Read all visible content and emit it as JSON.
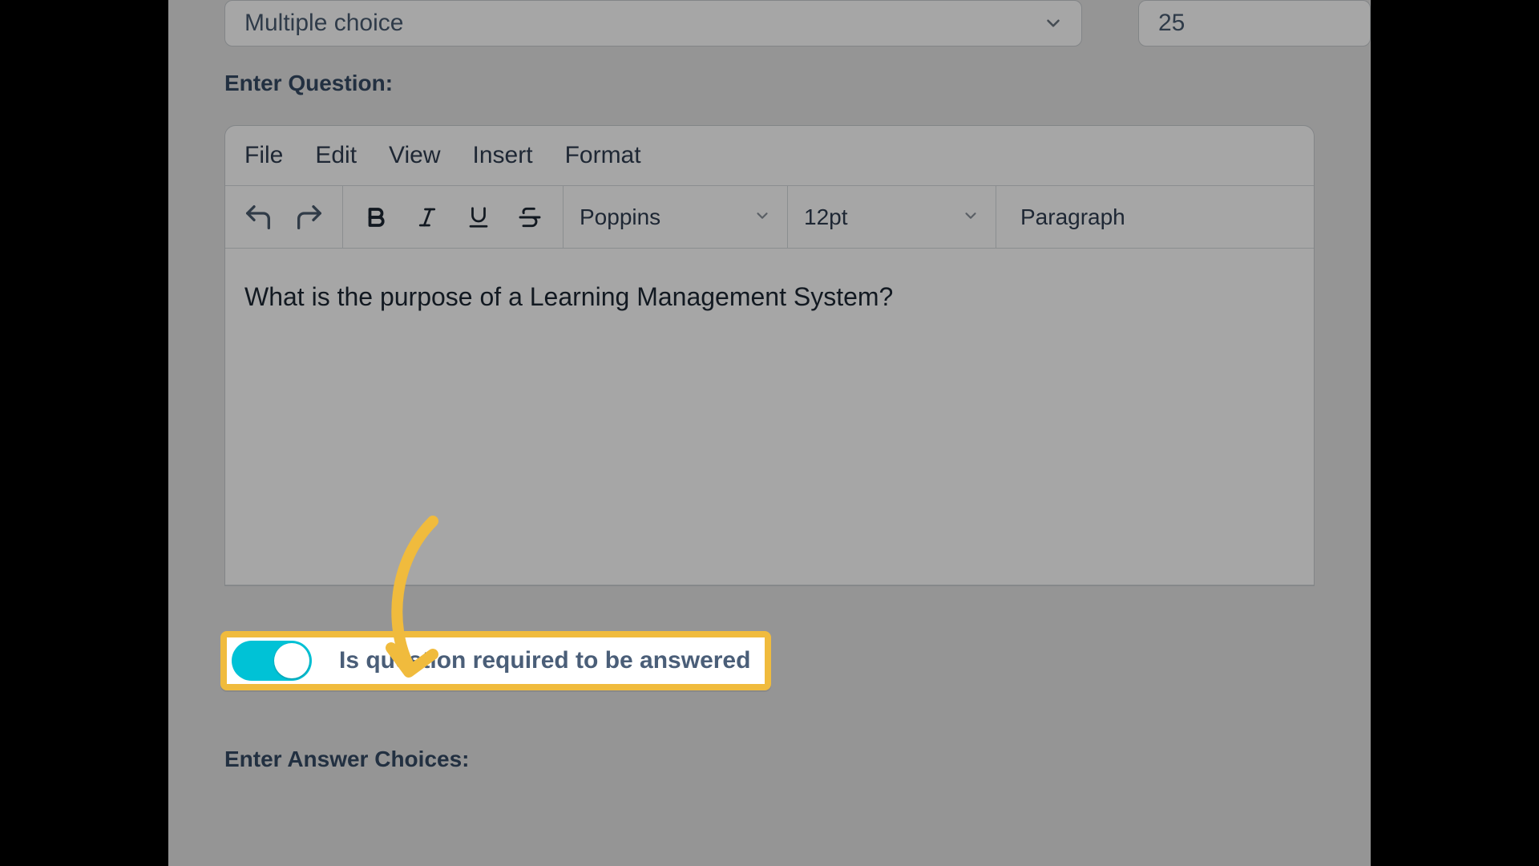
{
  "topRow": {
    "questionType": "Multiple choice",
    "points": "25"
  },
  "labels": {
    "enterQuestion": "Enter Question:",
    "enterAnswerChoices": "Enter Answer Choices:"
  },
  "editor": {
    "menu": {
      "file": "File",
      "edit": "Edit",
      "view": "View",
      "insert": "Insert",
      "format": "Format"
    },
    "toolbar": {
      "font": "Poppins",
      "size": "12pt",
      "block": "Paragraph"
    },
    "content": "What is the purpose of a Learning Management System?"
  },
  "requiredToggle": {
    "label": "Is question required to be answered",
    "on": true
  }
}
